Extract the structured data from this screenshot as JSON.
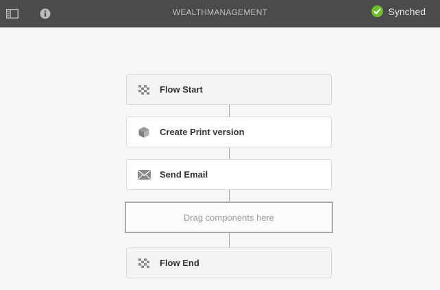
{
  "topbar": {
    "title": "WEALTHMANAGEMENT",
    "status": "Synched",
    "status_color": "#6fbf2c",
    "left_icons": [
      "side-panel-icon",
      "info-icon"
    ]
  },
  "flow": {
    "steps": [
      {
        "label": "Flow Start",
        "icon": "flow-start-icon"
      },
      {
        "label": "Create Print version",
        "icon": "cube-icon"
      },
      {
        "label": "Send Email",
        "icon": "envelope-icon"
      }
    ],
    "dropzone_text": "Drag components here",
    "end": {
      "label": "Flow End",
      "icon": "flow-end-icon"
    }
  }
}
